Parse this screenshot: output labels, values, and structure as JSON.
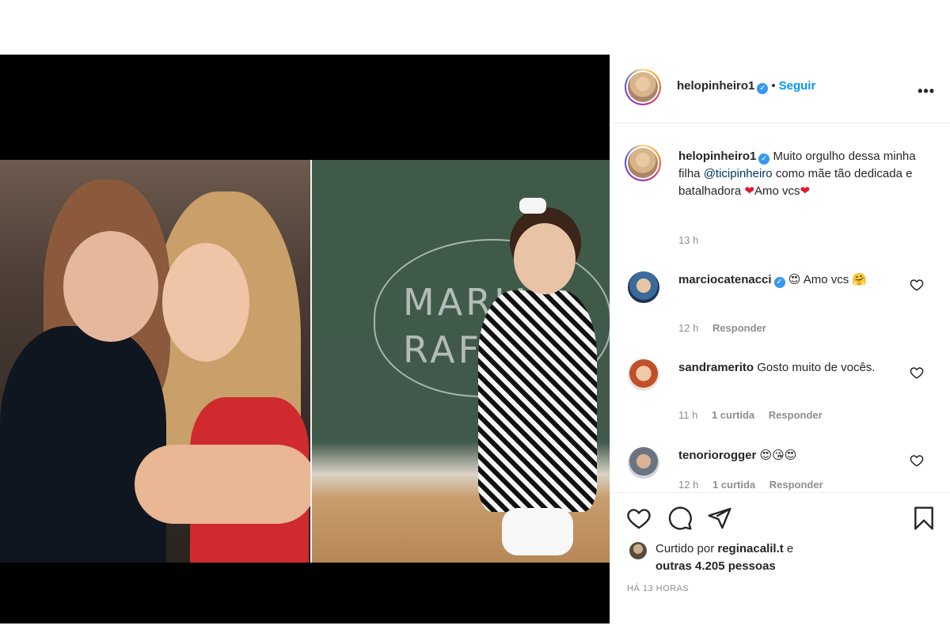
{
  "post": {
    "author": "helopinheiro1",
    "follow_label": "Seguir",
    "dot": "•",
    "more_label": "•••"
  },
  "caption": {
    "user": "helopinheiro1",
    "text_1": "Muito orgulho dessa minha filha",
    "mention": "@ticipinheiro",
    "text_2": "como mãe tão dedicada e batalhadora",
    "heart": "❤",
    "text_3": "Amo vcs",
    "time": "13 h"
  },
  "comments": [
    {
      "user": "marciocatenacci",
      "text": "😍 Amo vcs 🤗",
      "time": "12 h",
      "likes": "",
      "reply": "Responder"
    },
    {
      "user": "sandramerito",
      "text": "Gosto muito de vocês.",
      "time": "11 h",
      "likes": "1 curtida",
      "reply": "Responder"
    },
    {
      "user": "tenoriorogger",
      "text": "😍😘😍",
      "time": "12 h",
      "likes": "1 curtida",
      "reply": "Responder"
    }
  ],
  "likes": {
    "prefix": "Curtido por",
    "user": "reginacalil.t",
    "conj": "e",
    "others": "outras 4.205 pessoas"
  },
  "timestamp": "HÁ 13 HORAS",
  "chalk": {
    "line1": "MARIA",
    "line2": "RAFA"
  },
  "colors": {
    "link": "#0095f6",
    "verified": "#3897f0",
    "heart": "#e0182d"
  },
  "icons": [
    "verified-icon",
    "more-options-icon",
    "heart-icon",
    "comment-icon",
    "share-icon",
    "bookmark-icon"
  ]
}
